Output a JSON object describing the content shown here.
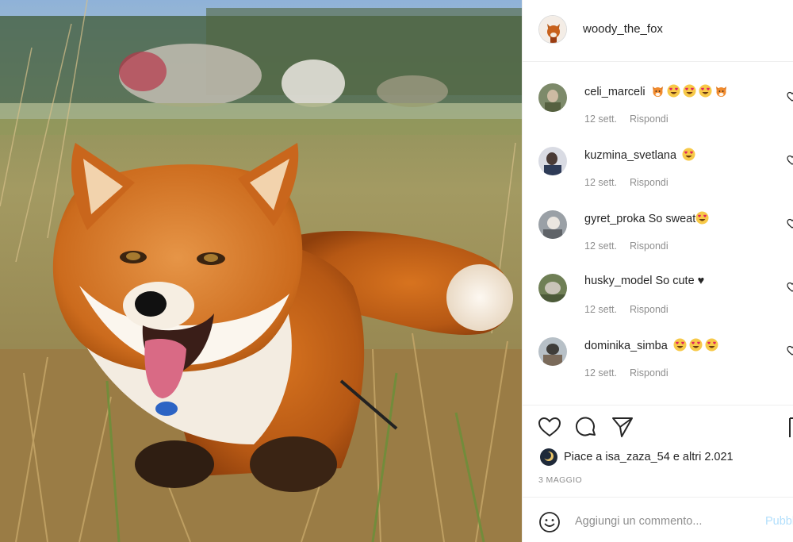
{
  "post": {
    "author": "woody_the_fox",
    "author_avatar_icon": "fox-avatar",
    "photo_description_icon": "fox-photo"
  },
  "comments": [
    {
      "user": "celi_marceli",
      "text": "",
      "emojis": [
        "fox-emoji",
        "heart-eyes-emoji",
        "heart-eyes-emoji",
        "heart-eyes-emoji",
        "fox-emoji"
      ],
      "time": "12 sett.",
      "reply": "Rispondi"
    },
    {
      "user": "kuzmina_svetlana",
      "text": "",
      "emojis": [
        "heart-eyes-emoji"
      ],
      "time": "12 sett.",
      "reply": "Rispondi"
    },
    {
      "user": "gyret_proka",
      "text": "So sweat",
      "emojis": [
        "heart-eyes-emoji"
      ],
      "time": "12 sett.",
      "reply": "Rispondi"
    },
    {
      "user": "husky_model",
      "text": "So cute ♥",
      "emojis": [],
      "time": "12 sett.",
      "reply": "Rispondi"
    },
    {
      "user": "dominika_simba",
      "text": "",
      "emojis": [
        "heart-eyes-emoji",
        "heart-eyes-emoji",
        "heart-eyes-emoji"
      ],
      "time": "12 sett.",
      "reply": "Rispondi"
    }
  ],
  "likes": {
    "text": "Piace a isa_zaza_54 e altri 2.021"
  },
  "date": "3 MAGGIO",
  "add_comment": {
    "placeholder": "Aggiungi un commento...",
    "publish": "Pubblica"
  },
  "colors": {
    "text": "#262626",
    "muted": "#8e8e8e",
    "divider": "#efefef",
    "publish_disabled": "#b2dffc"
  }
}
